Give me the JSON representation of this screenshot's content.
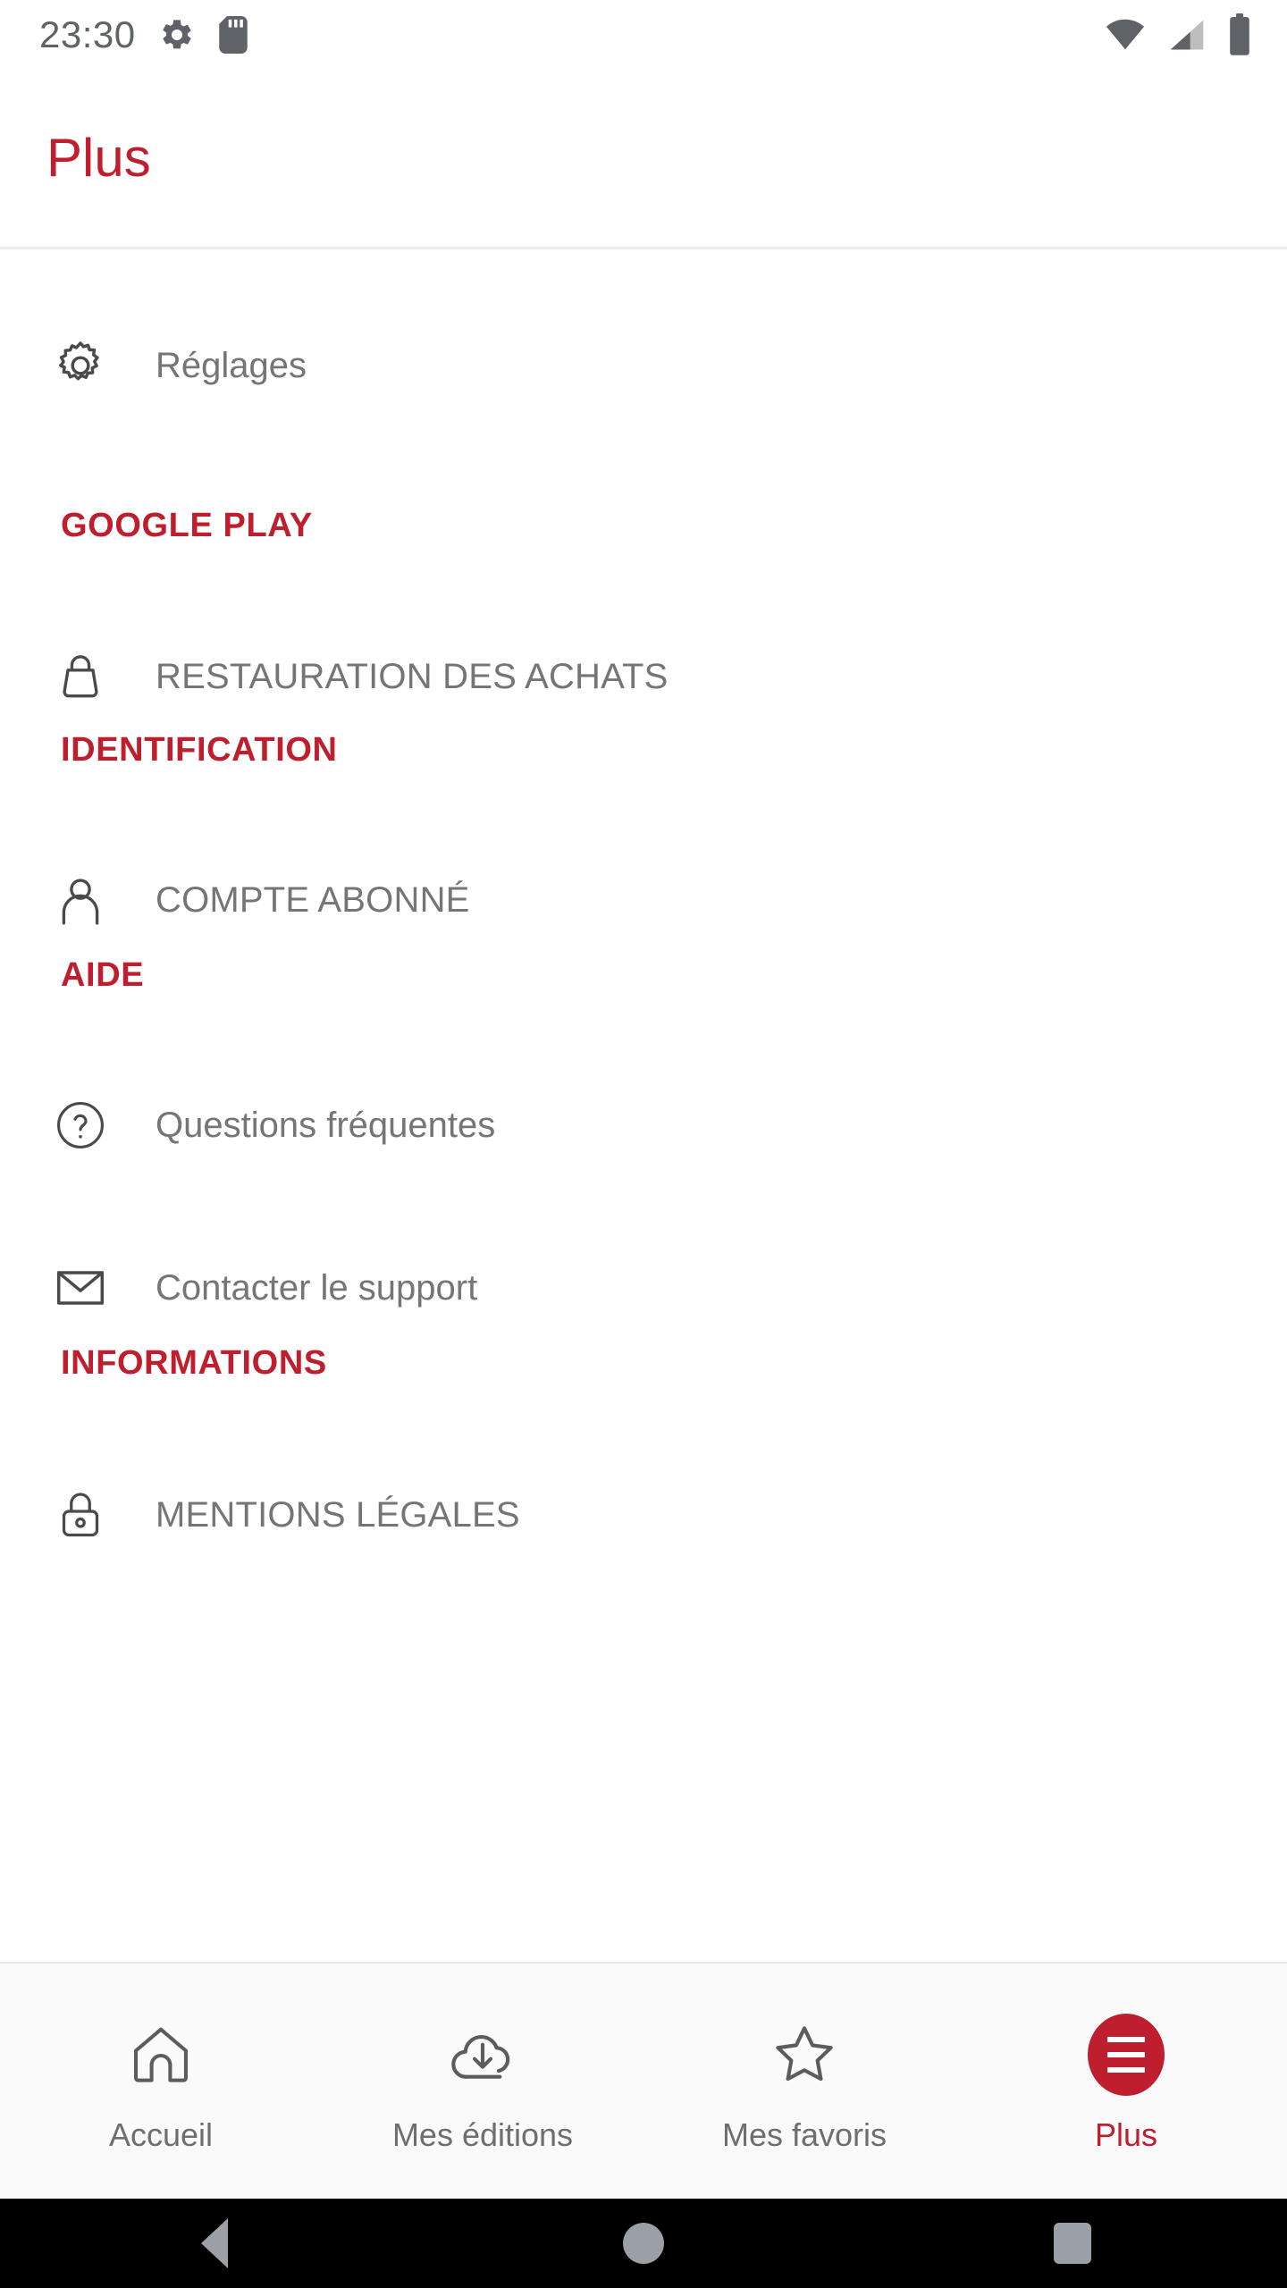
{
  "status_bar": {
    "time": "23:30",
    "left_icons": [
      "settings-gear-icon",
      "sd-card-icon"
    ],
    "right_icons": [
      "wifi-icon",
      "cellular-signal-icon",
      "battery-icon"
    ],
    "icon_color": "#5f6368"
  },
  "app_bar": {
    "title": "Plus",
    "title_color": "#BE1E2D"
  },
  "theme": {
    "accent_red": "#BE1E2D",
    "body_text_gray": "#757575",
    "background": "#FFFFFF"
  },
  "content": {
    "settings_row": {
      "label": "Réglages",
      "icon": "gear-icon"
    },
    "sections": [
      {
        "header": "GOOGLE PLAY",
        "items": [
          {
            "label": "RESTAURATION DES ACHATS",
            "icon": "shopping-bag-icon"
          }
        ]
      },
      {
        "header": "IDENTIFICATION",
        "items": [
          {
            "label": "COMPTE ABONNÉ",
            "icon": "person-icon"
          }
        ]
      },
      {
        "header": "AIDE",
        "items": [
          {
            "label": "Questions fréquentes",
            "icon": "question-mark-circle-icon"
          },
          {
            "label": "Contacter le support",
            "icon": "envelope-icon"
          }
        ]
      },
      {
        "header": "INFORMATIONS",
        "items": [
          {
            "label": "MENTIONS LÉGALES",
            "icon": "lock-icon"
          }
        ]
      }
    ]
  },
  "tab_bar": {
    "tabs": [
      {
        "label": "Accueil",
        "icon": "home-icon",
        "active": false
      },
      {
        "label": "Mes éditions",
        "icon": "cloud-download-icon",
        "active": false
      },
      {
        "label": "Mes favoris",
        "icon": "star-icon",
        "active": false
      },
      {
        "label": "Plus",
        "icon": "hamburger-menu-icon",
        "active": true
      }
    ]
  },
  "android_nav": {
    "buttons": [
      "back-icon",
      "home-icon",
      "recent-apps-icon"
    ]
  }
}
